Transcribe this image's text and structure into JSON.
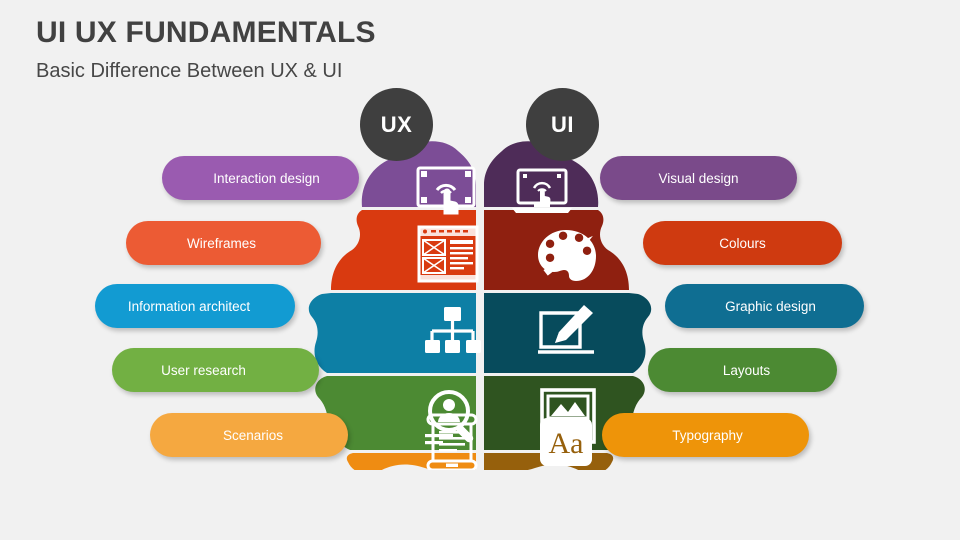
{
  "header": {
    "title": "UI UX FUNDAMENTALS",
    "subtitle": "Basic Difference Between UX & UI"
  },
  "badges": {
    "left": "UX",
    "right": "UI"
  },
  "colors": {
    "background": "#f1f1f1",
    "title": "#414141",
    "subtitle": "#474747",
    "badge": "#3f3f3f"
  },
  "rows": [
    {
      "index": 1,
      "left": {
        "label": "Interaction design",
        "pill_color": "#9a5bb0",
        "segment_color": "#7c4d96",
        "icon": "touch-screen-icon"
      },
      "right": {
        "label": "Visual design",
        "pill_color": "#7a4a8a",
        "segment_color": "#4e2c58",
        "icon": "laptop-touch-icon"
      }
    },
    {
      "index": 2,
      "left": {
        "label": "Wireframes",
        "pill_color": "#ec5b34",
        "segment_color": "#d93a10",
        "icon": "wireframe-icon"
      },
      "right": {
        "label": "Colours",
        "pill_color": "#cf3a10",
        "segment_color": "#8f2010",
        "icon": "paint-palette-icon"
      }
    },
    {
      "index": 3,
      "left": {
        "label": "Information architect",
        "pill_color": "#129bd2",
        "segment_color": "#0d7fa5",
        "icon": "sitemap-icon"
      },
      "right": {
        "label": "Graphic design",
        "pill_color": "#0f6e92",
        "segment_color": "#074b5c",
        "icon": "tablet-pen-icon"
      }
    },
    {
      "index": 4,
      "left": {
        "label": "User research",
        "pill_color": "#72b043",
        "segment_color": "#4c8a33",
        "icon": "user-search-icon"
      },
      "right": {
        "label": "Layouts",
        "pill_color": "#4c8a33",
        "segment_color": "#2f5420",
        "icon": "image-layout-icon"
      }
    },
    {
      "index": 5,
      "left": {
        "label": "Scenarios",
        "pill_color": "#f5a840",
        "segment_color": "#ef8c12",
        "icon": "scroll-document-icon"
      },
      "right": {
        "label": "Typography",
        "pill_color": "#ee9409",
        "segment_color": "#96600c",
        "icon": "typography-aa-icon"
      }
    }
  ],
  "typography_icon_text": "Aa"
}
